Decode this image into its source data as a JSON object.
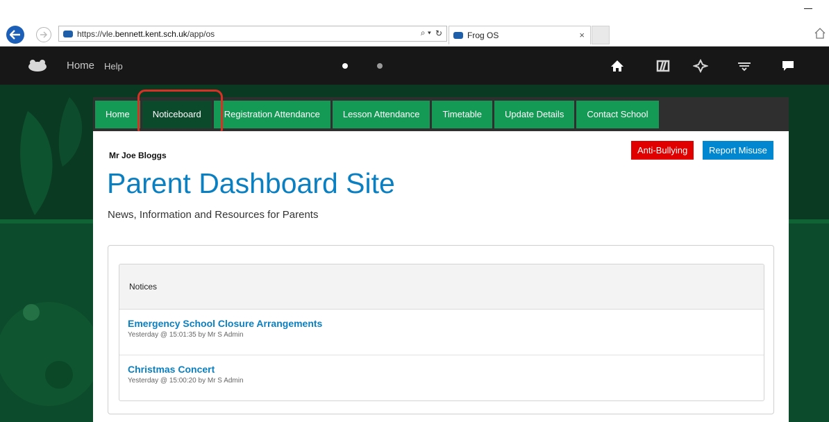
{
  "browser": {
    "url_prefix": "https://vle.",
    "url_domain": "bennett.kent.sch.uk",
    "url_path": "/app/os",
    "search_glyph": "⌕ ▾",
    "refresh_glyph": "↻",
    "tab_title": "Frog OS",
    "tab_close": "×"
  },
  "topbar": {
    "home_label": "Home",
    "help_label": "Help"
  },
  "nav": {
    "items": [
      {
        "label": "Home"
      },
      {
        "label": "Noticeboard"
      },
      {
        "label": "Registration Attendance"
      },
      {
        "label": "Lesson Attendance"
      },
      {
        "label": "Timetable"
      },
      {
        "label": "Update Details"
      },
      {
        "label": "Contact School"
      }
    ],
    "active_color": "#0b4a2b",
    "item_color": "#159a55"
  },
  "page": {
    "user_name": "Mr Joe Bloggs",
    "anti_bullying_label": "Anti-Bullying",
    "report_misuse_label": "Report Misuse",
    "title": "Parent Dashboard Site",
    "subtitle": "News, Information and Resources for Parents"
  },
  "notices": {
    "heading": "Notices",
    "items": [
      {
        "title": "Emergency School Closure Arrangements",
        "meta": "Yesterday @ 15:01:35 by Mr S Admin"
      },
      {
        "title": "Christmas Concert",
        "meta": "Yesterday @ 15:00:20 by Mr S Admin"
      }
    ]
  },
  "icons": [
    "back-arrow-icon",
    "forward-arrow-icon",
    "frog-favicon-icon",
    "home-icon",
    "apps-icon",
    "spinner-icon",
    "keyboard-icon",
    "chat-icon",
    "frog-logo-icon"
  ]
}
